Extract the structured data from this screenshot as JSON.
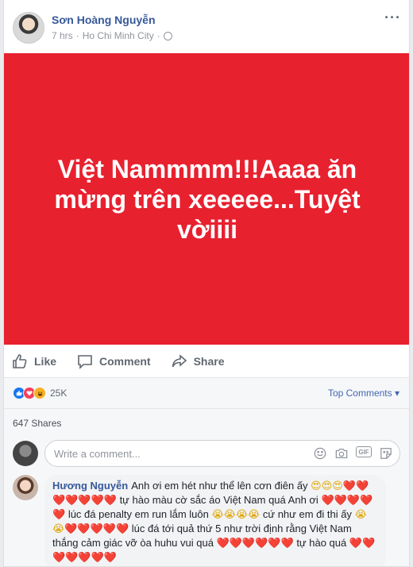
{
  "post": {
    "author": "Sơn Hoàng Nguyễn",
    "time": "7 hrs",
    "location": "Ho Chi Minh City",
    "separator": "·",
    "more": "···",
    "status_text": "Việt Nammmm!!!Aaaa ăn mừng trên xeeeee...Tuyệt vờiiii",
    "status_bg_color": "#e8212f"
  },
  "actions": {
    "like": "Like",
    "comment": "Comment",
    "share": "Share"
  },
  "reactions": {
    "count": "25K",
    "top_comments": "Top Comments ▾",
    "shares": "647 Shares"
  },
  "comment_input": {
    "placeholder": "Write a comment..."
  },
  "comment": {
    "author": "Hương Nguyễn",
    "segments": [
      "Anh ơi em hét như thể lên cơn điên ấy",
      "tự hào màu cờ sắc áo Việt Nam quá Anh ơi",
      "lúc đá penalty em run lắm luôn",
      "cứ như em đi thi ấy",
      "lúc đá tới quả thứ 5 như trời định rằng Việt Nam thắng cảm giác vỡ òa huhu vui quá",
      "tự hào quá"
    ]
  }
}
